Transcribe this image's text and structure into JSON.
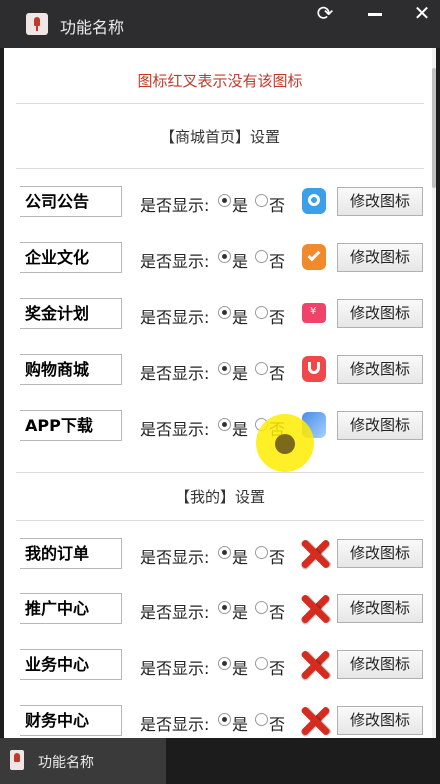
{
  "window": {
    "title": "功能名称",
    "refresh_glyph": "⟳"
  },
  "note": "图标红叉表示没有该图标",
  "sections": {
    "home_title": "【商城首页】设置",
    "mine_title": "【我的】设置"
  },
  "common": {
    "show_label": "是否显示:",
    "yes": "是",
    "no": "否",
    "edit_button": "修改图标"
  },
  "home_rows": [
    {
      "name": "公司公告",
      "selected": "是",
      "icon": "notice-icon",
      "icon_color": "#3aa0e8"
    },
    {
      "name": "企业文化",
      "selected": "是",
      "icon": "culture-icon",
      "icon_color": "#f08a2c"
    },
    {
      "name": "奖金计划",
      "selected": "是",
      "icon": "bonus-icon",
      "icon_color": "#f0436a"
    },
    {
      "name": "购物商城",
      "selected": "是",
      "icon": "shop-icon",
      "icon_color": "#f0474a"
    },
    {
      "name": "APP下载",
      "selected": "是",
      "icon": "app-download-icon",
      "icon_color": "#4a8de8"
    }
  ],
  "mine_rows": [
    {
      "name": "我的订单",
      "selected": "是",
      "icon": "missing-icon-x"
    },
    {
      "name": "推广中心",
      "selected": "是",
      "icon": "missing-icon-x"
    },
    {
      "name": "业务中心",
      "selected": "是",
      "icon": "missing-icon-x"
    },
    {
      "name": "财务中心",
      "selected": "是",
      "icon": "missing-icon-x"
    }
  ],
  "taskbar": {
    "label": "功能名称"
  },
  "colors": {
    "note_red": "#c0392b",
    "x_red": "#d62b1f",
    "titlebar": "#2d2d30",
    "cursor_highlight": "#ffec00"
  }
}
